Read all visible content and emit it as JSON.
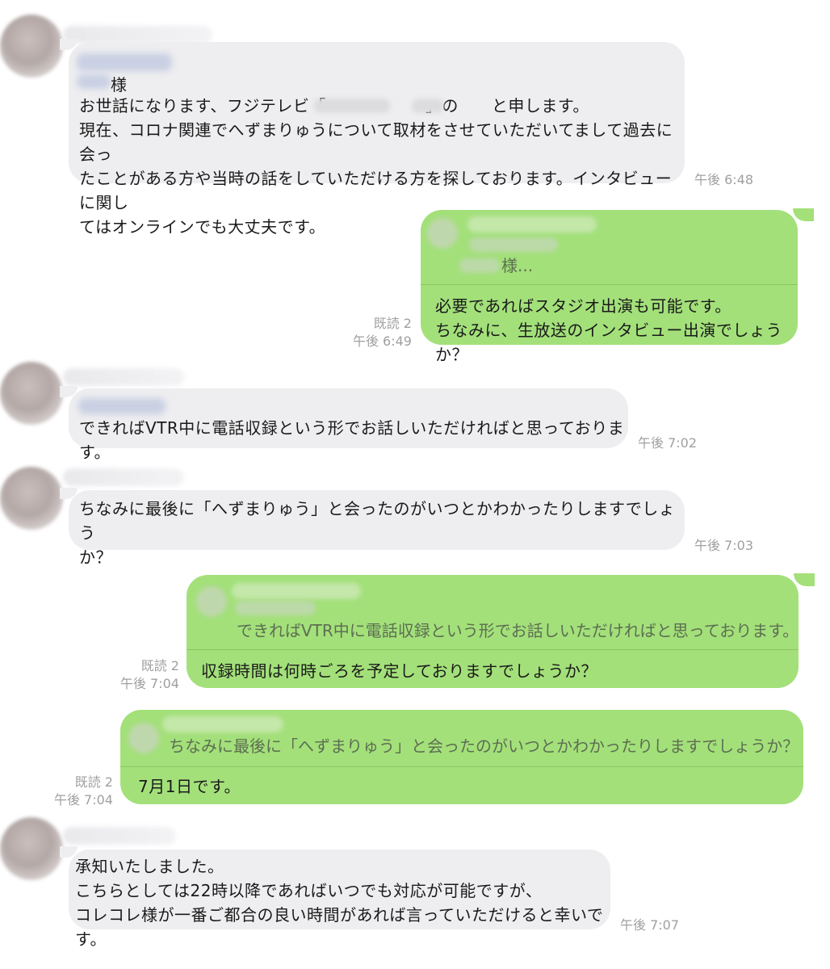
{
  "messages": {
    "m1": {
      "salutation": "様",
      "body": "お世話になります、フジテレビ「　　　　　　」の　　と申します。\n現在、コロナ関連でへずまりゅうについて取材をさせていただいてまして過去に会っ\nたことがある方や当時の話をしていただける方を探しております。インタビューに関し\nてはオンラインでも大丈夫です。",
      "time": "午後 6:48"
    },
    "m2": {
      "quote_text": "様...",
      "body": "必要であればスタジオ出演も可能です。\nちなみに、生放送のインタビュー出演でしょうか？",
      "read": "既読 2",
      "time": "午後 6:49"
    },
    "m3": {
      "body": "できればVTR中に電話収録という形でお話しいただければと思っております。",
      "time": "午後 7:02"
    },
    "m4": {
      "body": "ちなみに最後に「へずまりゅう」と会ったのがいつとかわかったりしますでしょう\nか？",
      "time": "午後 7:03"
    },
    "m5": {
      "quote_text": "できればVTR中に電話収録という形でお話しいただければと思っております。",
      "body": "収録時間は何時ごろを予定しておりますでしょうか？",
      "read": "既読 2",
      "time": "午後 7:04"
    },
    "m6": {
      "quote_text": "ちなみに最後に「へずまりゅう」と会ったのがいつとかわかったりしますでしょうか？",
      "body": "7月1日です。",
      "read": "既読 2",
      "time": "午後 7:04"
    },
    "m7": {
      "body": "承知いたしました。\nこちらとしては22時以降であればいつでも対応が可能ですが、\nコレコレ様が一番ご都合の良い時間があれば言っていただけると幸いです。",
      "time": "午後 7:07"
    }
  },
  "colors": {
    "incoming_bubble": "#eeeef0",
    "outgoing_bubble": "#a3e07a",
    "timestamp": "#a0a0a0"
  }
}
